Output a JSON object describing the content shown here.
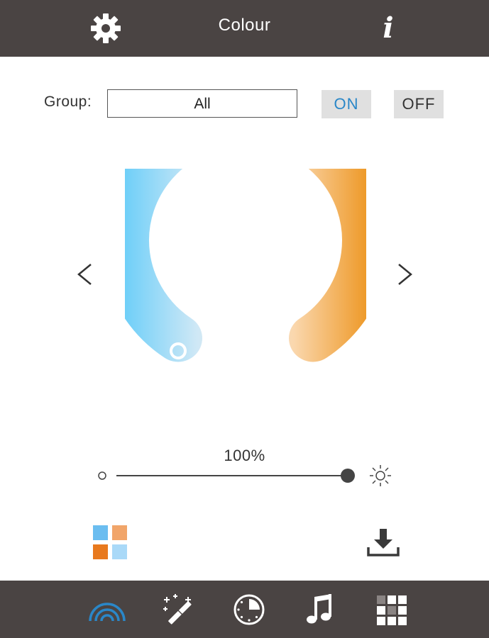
{
  "header": {
    "title": "Colour",
    "left_icon": "gear-icon",
    "right_icon": "info-icon",
    "info_glyph": "i"
  },
  "group": {
    "label": "Group:",
    "value": "All",
    "on_label": "ON",
    "off_label": "OFF"
  },
  "colour_wheel": {
    "cold_color": "#6fcff8",
    "warm_color": "#ee9a2a",
    "prev_icon": "chevron-left-icon",
    "next_icon": "chevron-right-icon"
  },
  "brightness": {
    "value_label": "100%",
    "value": 100,
    "min_icon": "dim-dot-icon",
    "max_icon": "sun-icon"
  },
  "actions": {
    "palette_icon": "palette-icon",
    "palette_colors": [
      "#6bbdf0",
      "#f1a56a",
      "#e8791e",
      "#a9d9f8"
    ],
    "download_icon": "download-icon"
  },
  "bottom_nav": [
    {
      "name": "colour-tab",
      "icon": "rainbow-icon",
      "active": true
    },
    {
      "name": "effects-tab",
      "icon": "magic-wand-icon",
      "active": false
    },
    {
      "name": "timer-tab",
      "icon": "clock-icon",
      "active": false
    },
    {
      "name": "music-tab",
      "icon": "music-note-icon",
      "active": false
    },
    {
      "name": "scenes-tab",
      "icon": "grid-icon",
      "active": false
    }
  ],
  "colors": {
    "bar": "#4a4443",
    "accent": "#2a87c8"
  }
}
